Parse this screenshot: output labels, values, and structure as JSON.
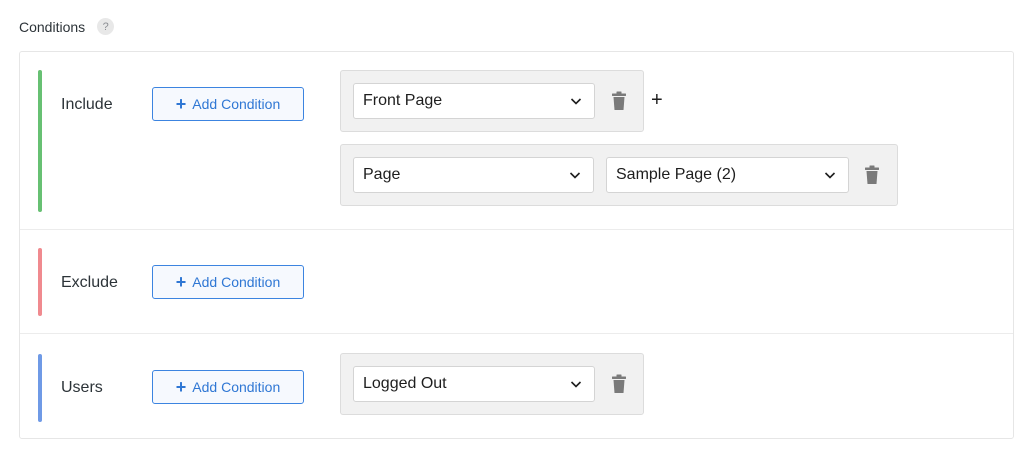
{
  "heading": {
    "title": "Conditions",
    "help": "?"
  },
  "sections": {
    "include": {
      "label": "Include",
      "add_button": "Add Condition",
      "add_plus": "+",
      "rules": [
        {
          "select1": "Front Page",
          "extra_plus": "+"
        },
        {
          "select1": "Page",
          "select2": "Sample Page (2)"
        }
      ]
    },
    "exclude": {
      "label": "Exclude",
      "add_button": "Add Condition",
      "add_plus": "+"
    },
    "users": {
      "label": "Users",
      "add_button": "Add Condition",
      "add_plus": "+",
      "rules": [
        {
          "select1": "Logged Out"
        }
      ]
    }
  },
  "colors": {
    "include_accent": "#67c073",
    "exclude_accent": "#f08a8f",
    "users_accent": "#6f9ae6",
    "button_blue": "#2f77d4"
  },
  "icons": {
    "help": "question-icon",
    "delete": "trash-icon",
    "dropdown": "chevron-down-icon",
    "add": "plus-icon"
  }
}
